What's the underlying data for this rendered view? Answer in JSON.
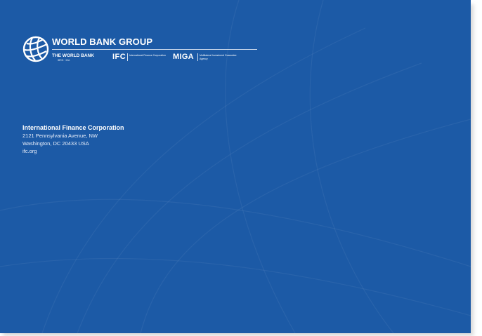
{
  "logo": {
    "group_name": "WORLD BANK GROUP",
    "institutions": {
      "world_bank": {
        "name": "THE WORLD BANK",
        "sub": "IBRD · IDA"
      },
      "ifc": {
        "abbr": "IFC",
        "name": "International Finance Corporation"
      },
      "miga": {
        "abbr": "MIGA",
        "name": "Multilateral Investment Guarantee Agency"
      }
    }
  },
  "address": {
    "organization": "International Finance Corporation",
    "street": "2121 Pennsylvania Avenue, NW",
    "city": "Washington, DC 20433 USA",
    "website": "ifc.org"
  },
  "colors": {
    "background": "#1c5aa6",
    "text": "#ffffff"
  }
}
